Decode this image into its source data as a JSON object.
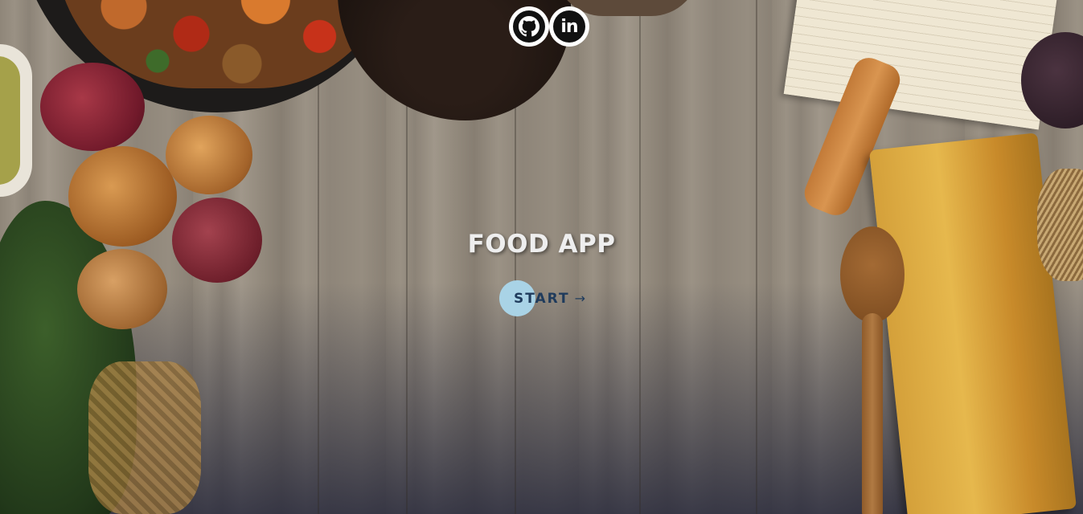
{
  "header": {
    "social_links": [
      {
        "icon": "github-icon",
        "label": "GitHub"
      },
      {
        "icon": "linkedin-icon",
        "label": "in"
      }
    ]
  },
  "hero": {
    "title": "FOOD APP",
    "start_label": "START",
    "start_arrow": "→"
  },
  "colors": {
    "title": "#eeeeee",
    "start_circle": "#a9d3e6",
    "start_text": "#1f3b5c",
    "icon_bg": "#111111",
    "icon_ring": "#ffffff"
  }
}
